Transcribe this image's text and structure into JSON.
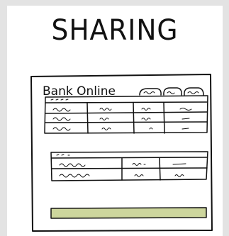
{
  "heading": "SHARING",
  "panel": {
    "title": "Bank Online",
    "buttons": [
      {
        "label": "",
        "name": "header-tab-1"
      },
      {
        "label": "",
        "name": "header-tab-2"
      },
      {
        "label": "",
        "name": "header-tab-3"
      }
    ]
  },
  "colors": {
    "background": "#e3e3e3",
    "card": "#ffffff",
    "ink": "#111111",
    "bar_fill": "#cdd69d"
  }
}
